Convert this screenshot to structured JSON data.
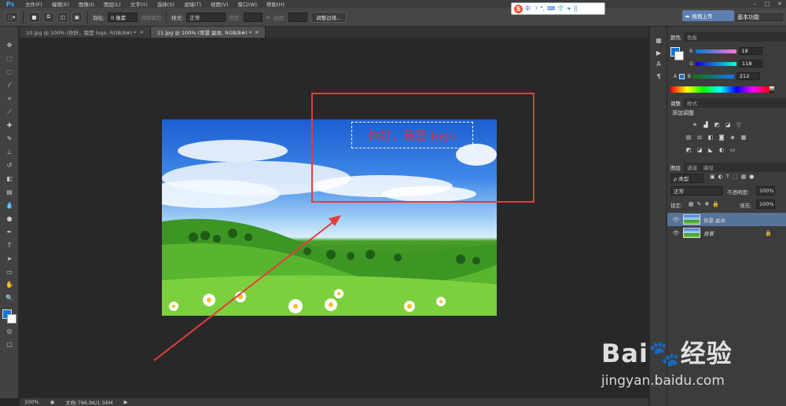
{
  "menubar": {
    "app_icon": "Ps",
    "items": [
      "文件(F)",
      "编辑(E)",
      "图像(I)",
      "图层(L)",
      "文字(Y)",
      "选择(S)",
      "滤镜(T)",
      "视图(V)",
      "窗口(W)",
      "帮助(H)"
    ],
    "minimize": "–",
    "maximize": "□",
    "close": "✕"
  },
  "options": {
    "feather_label": "羽化:",
    "feather_value": "0 像素",
    "antialias_label": "消除锯齿",
    "style_label": "样式:",
    "style_value": "正常",
    "width_label": "宽度:",
    "height_label": "高度:",
    "refine_button": "调整边缘...",
    "ime_logo": "S",
    "ime_items": [
      "中",
      "☽",
      "°,",
      "⌨",
      "👕",
      "❧",
      "⣿"
    ],
    "upload_label": "拖拽上传",
    "workspace": "基本功能"
  },
  "tabs": [
    {
      "label": "10.jpg @ 100% (你好，我是 logo, RGB/8#) *",
      "close": "×"
    },
    {
      "label": "11.jpg @ 100% (背景 副本, RGB/8#) *",
      "close": "×"
    }
  ],
  "canvas": {
    "logo_text": "你好，我是 logo"
  },
  "status": {
    "zoom": "100%",
    "doc": "文档:796.9K/1.56M"
  },
  "color_panel": {
    "tabs": [
      "颜色",
      "色板"
    ],
    "r_label": "R",
    "r_value": "18",
    "g_label": "G",
    "g_value": "118",
    "b_label": "B",
    "b_value": "212",
    "foreground": "#1276d4"
  },
  "adjust_panel": {
    "tabs": [
      "调整",
      "样式"
    ],
    "title": "添加调整"
  },
  "layers_panel": {
    "tabs": [
      "图层",
      "通道",
      "路径"
    ],
    "kind_label": "ρ 类型",
    "blend_mode": "正常",
    "opacity_label": "不透明度:",
    "opacity_value": "100%",
    "lock_label": "锁定:",
    "fill_label": "填充:",
    "fill_value": "100%",
    "layers": [
      {
        "name": "背景 副本",
        "selected": true
      },
      {
        "name": "背景",
        "selected": false
      }
    ]
  },
  "watermark": {
    "brand": "Bai🐾经验",
    "url": "jingyan.baidu.com"
  },
  "colors": {
    "annotation_red": "#e53c3c",
    "logo_red": "#d8353f",
    "selected_layer": "#56739a"
  }
}
